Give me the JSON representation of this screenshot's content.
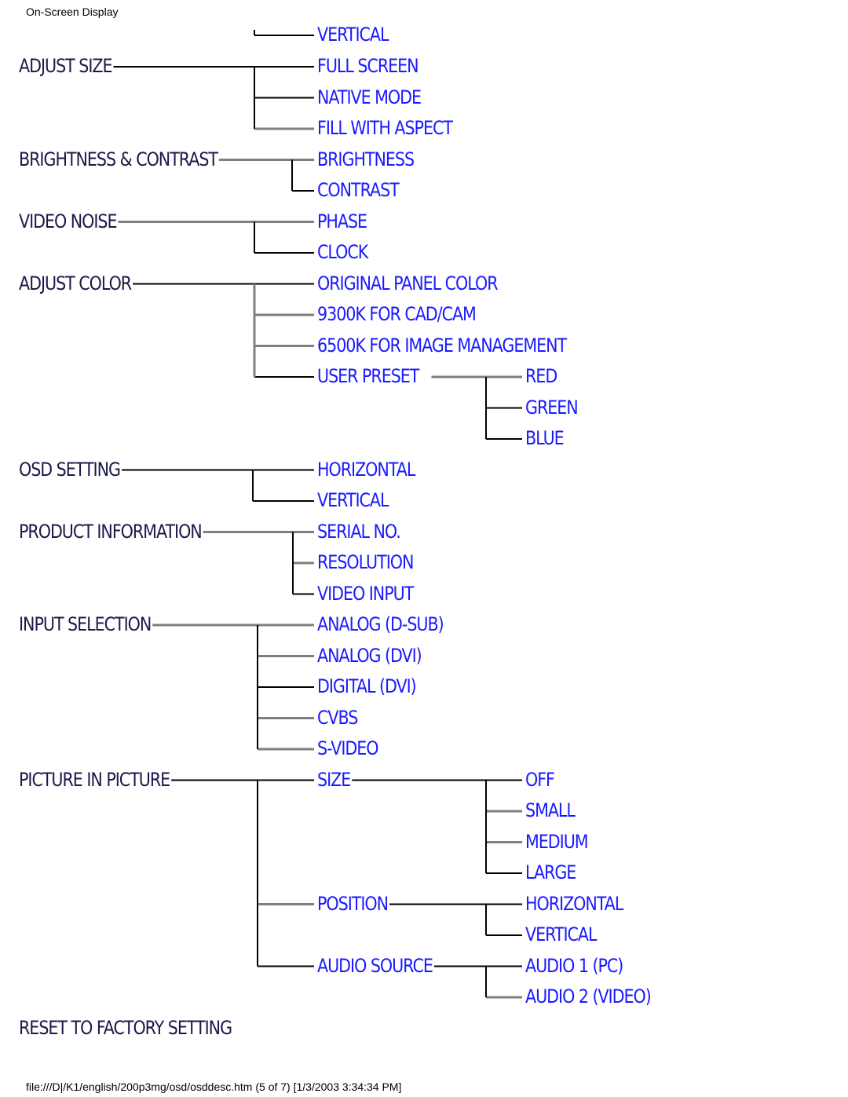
{
  "header": {
    "title": "On-Screen Display"
  },
  "footer": {
    "text": "file:///D|/K1/english/200p3mg/osd/osddesc.htm (5 of 7) [1/3/2003 3:34:34 PM]"
  },
  "colors": {
    "top_level_text": "#1a1a4a",
    "sub_item_text": "#1a1aff",
    "line_dark": "#000000",
    "line_gray": "#7f7f7f"
  },
  "diagram": {
    "title": "OSD menu tree",
    "partial_top_item": {
      "label": "VERTICAL"
    },
    "menus": [
      {
        "label": "ADJUST SIZE",
        "children": [
          {
            "label": "FULL SCREEN"
          },
          {
            "label": "NATIVE MODE"
          },
          {
            "label": "FILL WITH ASPECT"
          }
        ]
      },
      {
        "label": "BRIGHTNESS & CONTRAST",
        "children": [
          {
            "label": "BRIGHTNESS"
          },
          {
            "label": "CONTRAST"
          }
        ]
      },
      {
        "label": "VIDEO NOISE",
        "children": [
          {
            "label": "PHASE"
          },
          {
            "label": "CLOCK"
          }
        ]
      },
      {
        "label": "ADJUST COLOR",
        "children": [
          {
            "label": "ORIGINAL PANEL COLOR"
          },
          {
            "label": "9300K FOR CAD/CAM"
          },
          {
            "label": "6500K FOR IMAGE MANAGEMENT"
          },
          {
            "label": "USER PRESET",
            "children": [
              {
                "label": "RED"
              },
              {
                "label": "GREEN"
              },
              {
                "label": "BLUE"
              }
            ]
          }
        ]
      },
      {
        "label": "OSD SETTING",
        "children": [
          {
            "label": "HORIZONTAL"
          },
          {
            "label": "VERTICAL"
          }
        ]
      },
      {
        "label": "PRODUCT INFORMATION",
        "children": [
          {
            "label": "SERIAL NO."
          },
          {
            "label": "RESOLUTION"
          },
          {
            "label": "VIDEO INPUT"
          }
        ]
      },
      {
        "label": "INPUT SELECTION",
        "children": [
          {
            "label": "ANALOG (D-SUB)"
          },
          {
            "label": "ANALOG (DVI)"
          },
          {
            "label": "DIGITAL (DVI)"
          },
          {
            "label": "CVBS"
          },
          {
            "label": "S-VIDEO"
          }
        ]
      },
      {
        "label": "PICTURE IN PICTURE",
        "children": [
          {
            "label": "SIZE",
            "children": [
              {
                "label": "OFF"
              },
              {
                "label": "SMALL"
              },
              {
                "label": "MEDIUM"
              },
              {
                "label": "LARGE"
              }
            ]
          },
          {
            "label": "POSITION",
            "children": [
              {
                "label": "HORIZONTAL"
              },
              {
                "label": "VERTICAL"
              }
            ]
          },
          {
            "label": "AUDIO SOURCE",
            "children": [
              {
                "label": "AUDIO 1 (PC)"
              },
              {
                "label": "AUDIO 2 (VIDEO)"
              }
            ]
          }
        ]
      },
      {
        "label": "RESET TO FACTORY SETTING",
        "children": []
      }
    ]
  }
}
